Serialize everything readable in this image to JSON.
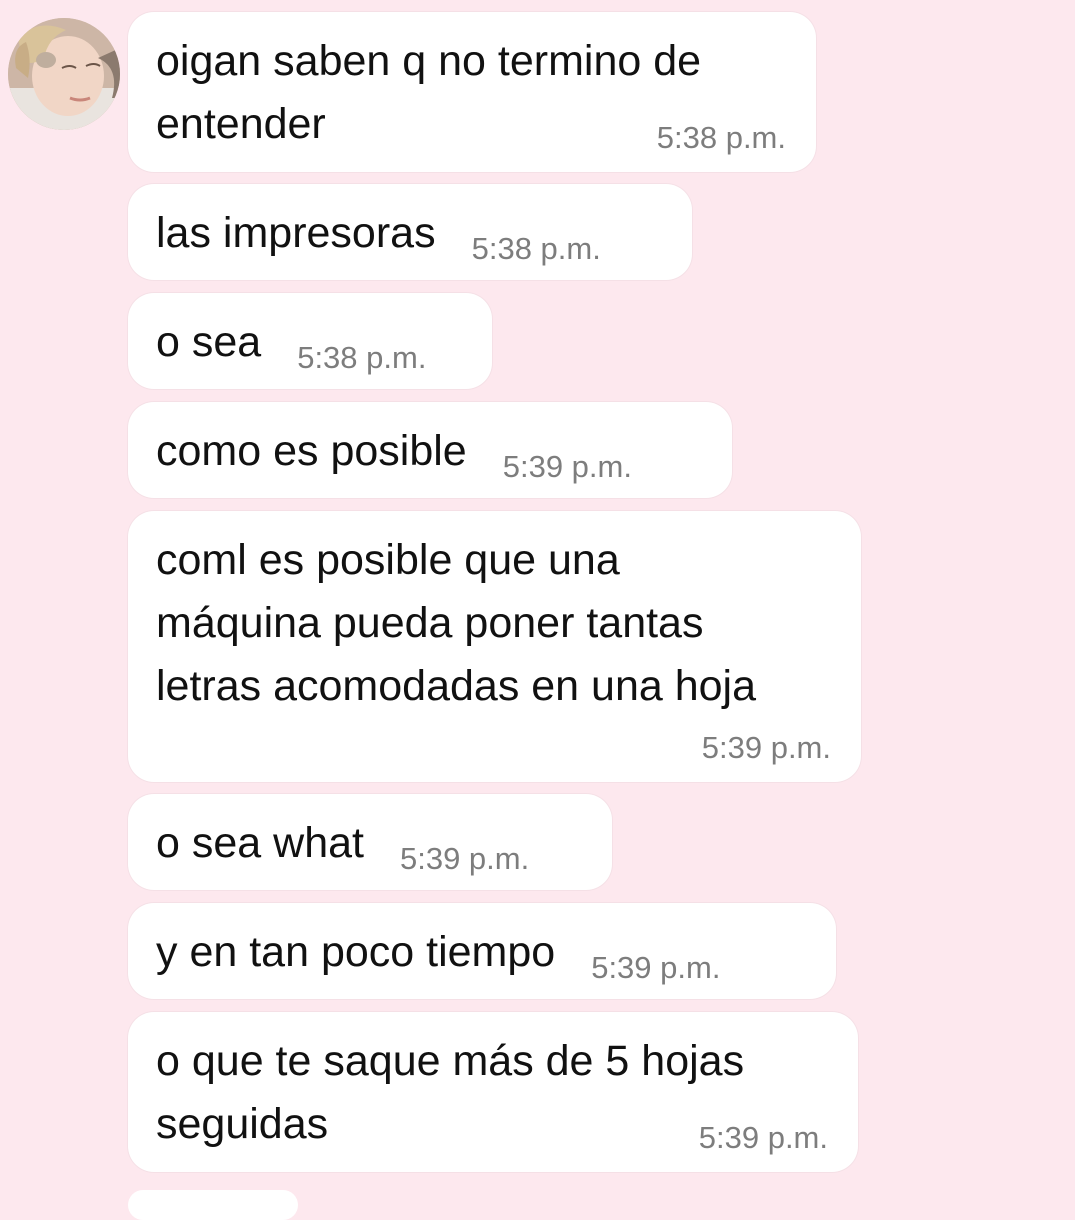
{
  "chat": {
    "messages": [
      {
        "text": "oigan saben q no termino de\nentender",
        "time": "5:38 p.m."
      },
      {
        "text": "las impresoras",
        "time": "5:38 p.m."
      },
      {
        "text": "o sea",
        "time": "5:38 p.m."
      },
      {
        "text": "como es posible",
        "time": "5:39 p.m."
      },
      {
        "text": "coml es posible que una\nmáquina pueda poner tantas\nletras acomodadas en una hoja",
        "time": "5:39 p.m."
      },
      {
        "text": "o sea what",
        "time": "5:39 p.m."
      },
      {
        "text": "y en tan poco tiempo",
        "time": "5:39 p.m."
      },
      {
        "text": "o que te saque más de 5 hojas\nseguidas",
        "time": "5:39 p.m."
      }
    ]
  },
  "colors": {
    "background": "#fde8ee",
    "bubble": "#ffffff",
    "text": "#111111",
    "timestamp": "#7d7d7d"
  },
  "icons": {
    "avatar": "sender-avatar-photo"
  }
}
